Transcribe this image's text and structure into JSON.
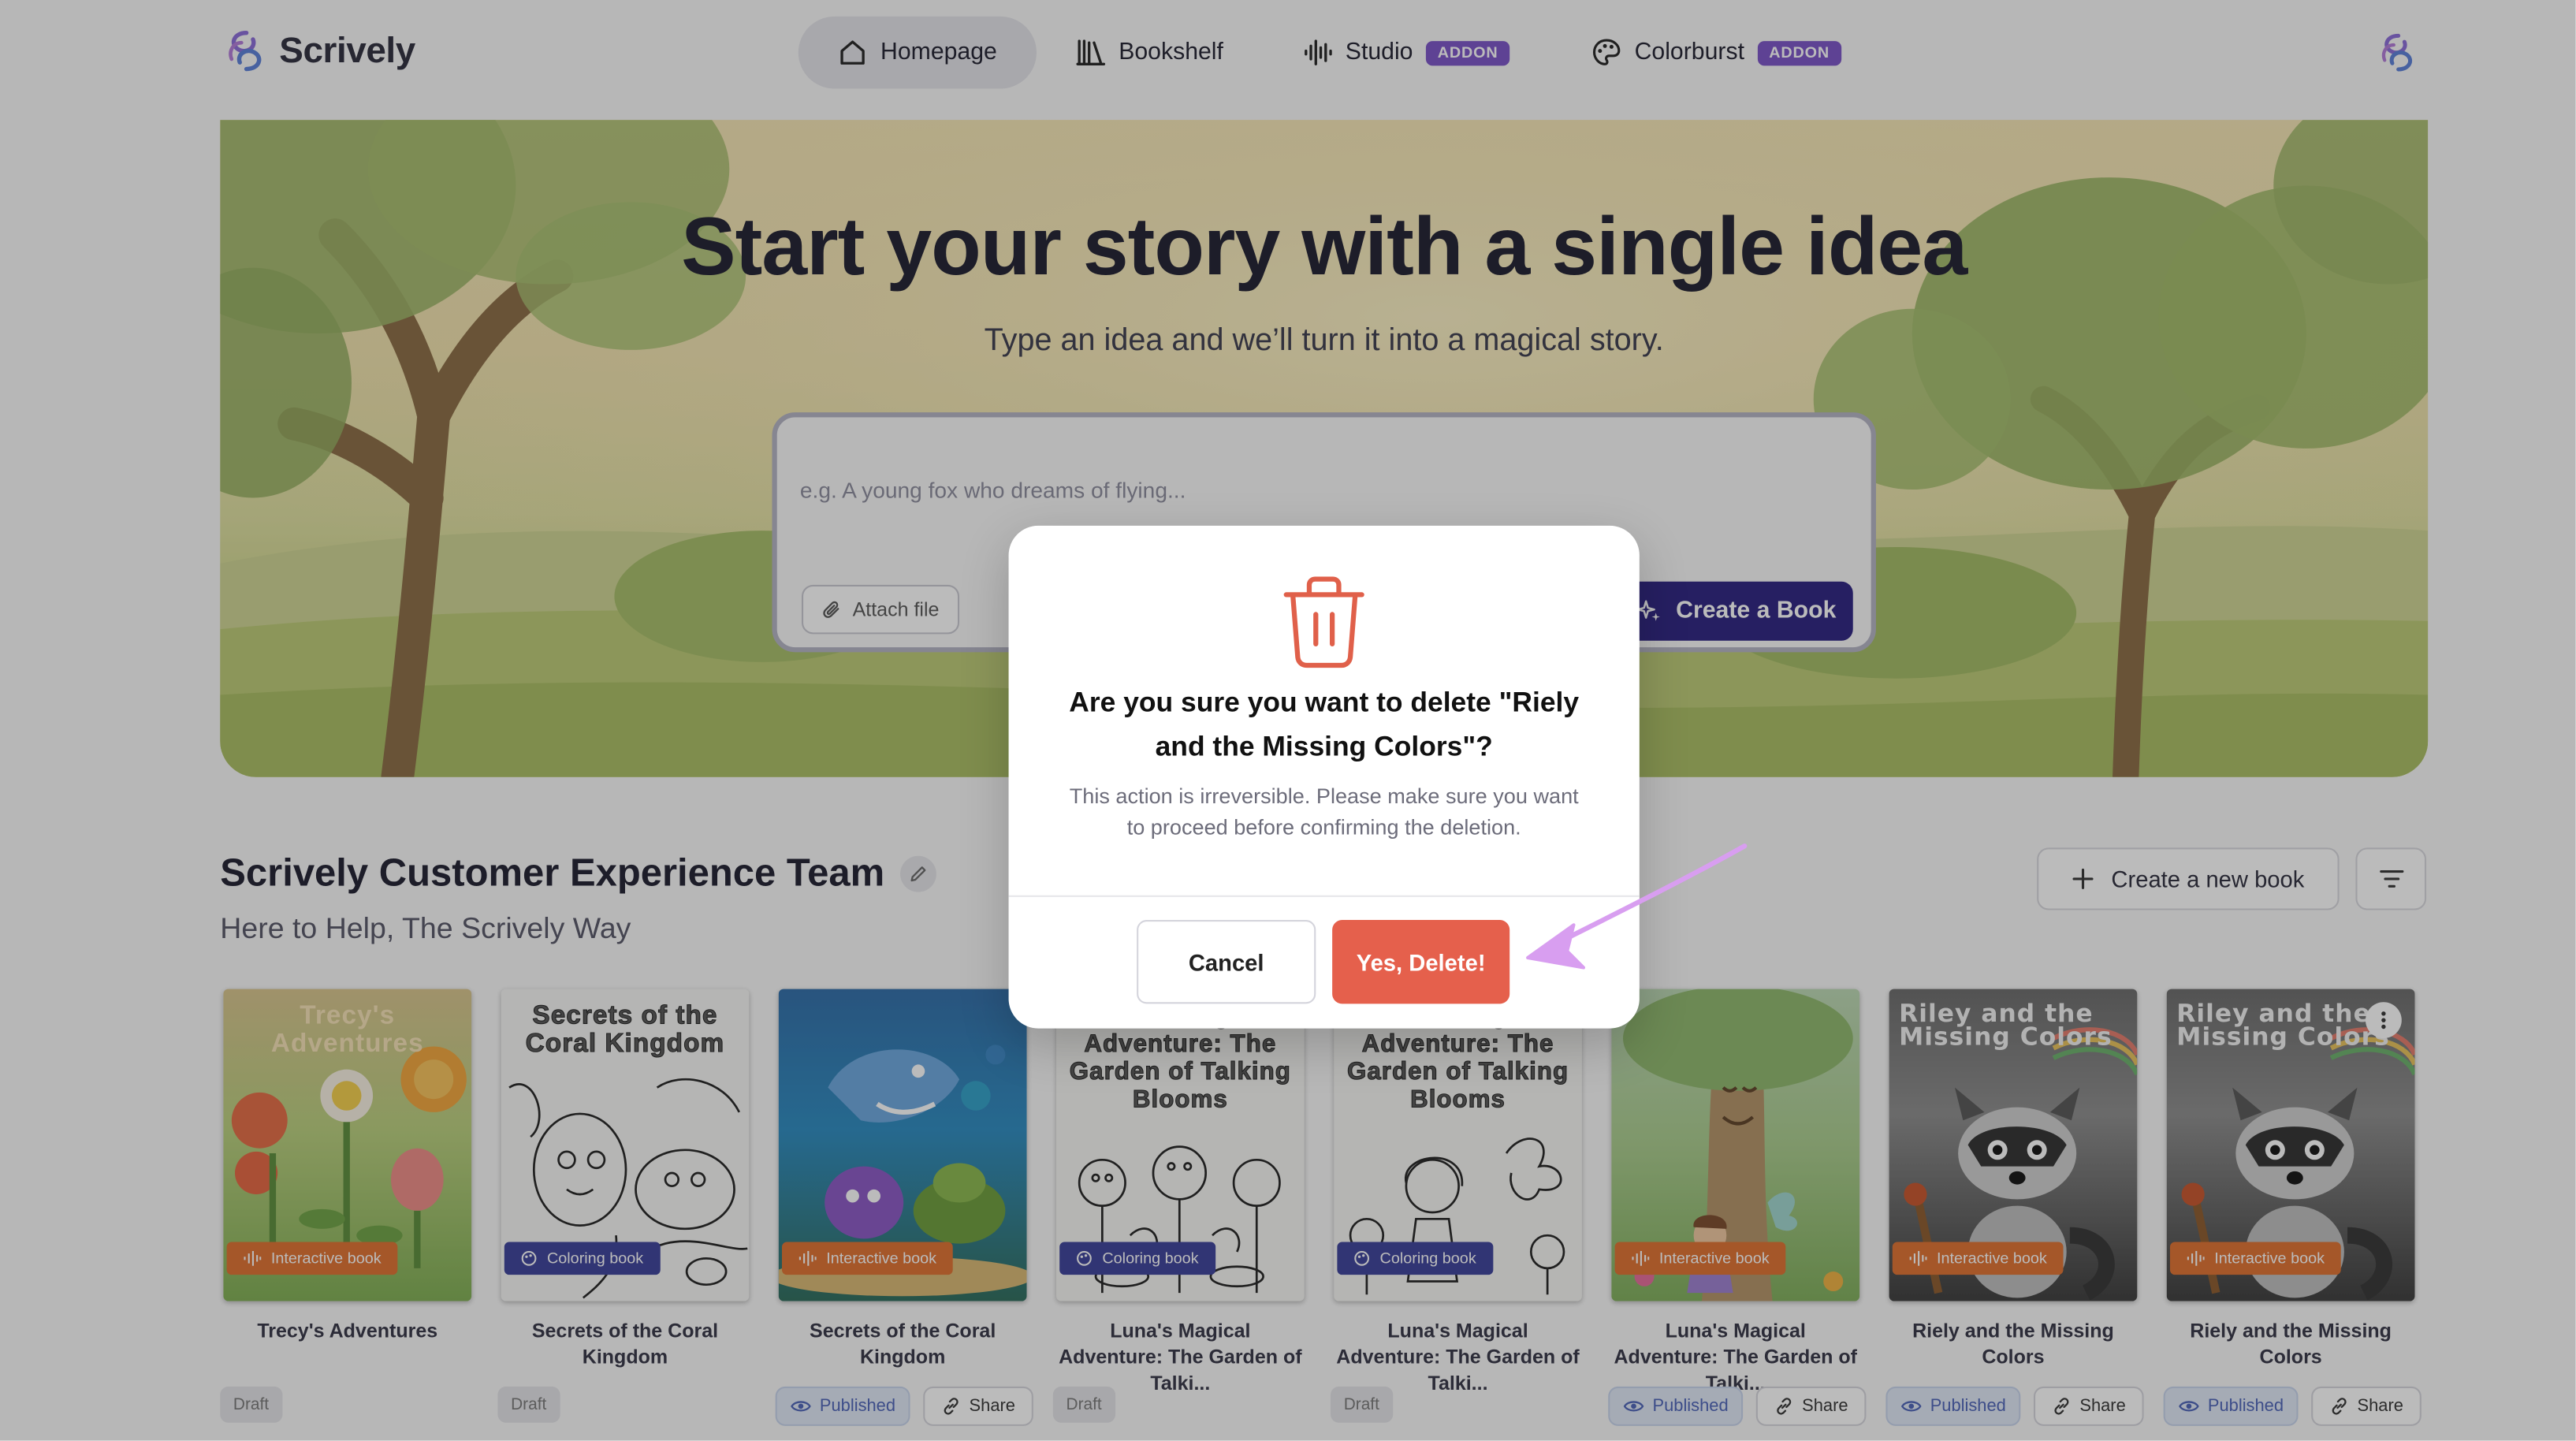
{
  "app": {
    "name": "Scrively"
  },
  "nav": {
    "items": [
      {
        "label": "Homepage",
        "icon": "home-icon",
        "active": true
      },
      {
        "label": "Bookshelf",
        "icon": "bookshelf-icon"
      },
      {
        "label": "Studio",
        "icon": "audio-wave-icon",
        "badge": "ADDON"
      },
      {
        "label": "Colorburst",
        "icon": "palette-icon",
        "badge": "ADDON"
      }
    ]
  },
  "hero": {
    "title": "Start your story with a single idea",
    "subtitle": "Type an idea and we’ll turn it into a magical story.",
    "input_placeholder": "e.g. A young fox who dreams of flying...",
    "attach_label": "Attach file",
    "create_label": "Create a Book"
  },
  "team": {
    "title": "Scrively Customer Experience Team",
    "subtitle": "Here to Help, The Scrively Way",
    "new_book_label": "Create a new book"
  },
  "books": [
    {
      "cover_title": "Trecy's Adventures",
      "type": "Interactive book",
      "name": "Trecy's Adventures",
      "status": "Draft"
    },
    {
      "cover_title": "Secrets of the Coral Kingdom",
      "type": "Coloring book",
      "name": "Secrets of the Coral Kingdom",
      "status": "Draft"
    },
    {
      "cover_title": "",
      "type": "Interactive book",
      "name": "Secrets of the Coral Kingdom",
      "status": "Published",
      "share": "Share"
    },
    {
      "cover_title": "Luna's Magical Adventure: The Garden of Talking Blooms",
      "type": "Coloring book",
      "name": "Luna's Magical Adventure: The Garden of Talki...",
      "status": "Draft"
    },
    {
      "cover_title": "Luna's Magical Adventure: The Garden of Talking Blooms",
      "type": "Coloring book",
      "name": "Luna's Magical Adventure: The Garden of Talki...",
      "status": "Draft"
    },
    {
      "cover_title": "",
      "type": "Interactive book",
      "name": "Luna's Magical Adventure: The Garden of Talki...",
      "status": "Published",
      "share": "Share"
    },
    {
      "cover_title": "Riley and the Missing Colors",
      "type": "Interactive book",
      "name": "Riely and the Missing Colors",
      "status": "Published",
      "share": "Share"
    },
    {
      "cover_title": "Riley and the Missing Colors",
      "type": "Interactive book",
      "name": "Riely and the Missing Colors",
      "status": "Published",
      "share": "Share"
    }
  ],
  "modal": {
    "title": "Are you sure you want to delete \"Riely and the Missing Colors\"?",
    "text": "This action is irreversible. Please make sure you want to proceed before confirming the deletion.",
    "cancel_label": "Cancel",
    "confirm_label": "Yes, Delete!",
    "icon": "trash-icon"
  },
  "colors": {
    "accent": "#2a2080",
    "addon": "#7a52c7",
    "danger": "#e5604c",
    "interactive_badge": "#e0702f",
    "coloring_badge": "#3a3f9a"
  }
}
